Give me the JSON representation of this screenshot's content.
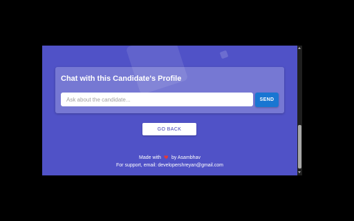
{
  "colors": {
    "page_background": "#5052c7",
    "send_button": "#1976d2",
    "heart": "#e53935"
  },
  "chat_card": {
    "title": "Chat with this Candidate's Profile",
    "input_value": "",
    "input_placeholder": "Ask about the candidate...",
    "send_label": "SEND"
  },
  "back_button_label": "GO BACK",
  "footer": {
    "made_with_prefix": "Made with",
    "heart_icon": "heart-icon",
    "made_with_suffix": "by Asambhav",
    "support_text": "For support, email: developershreyan@gmail.com"
  }
}
